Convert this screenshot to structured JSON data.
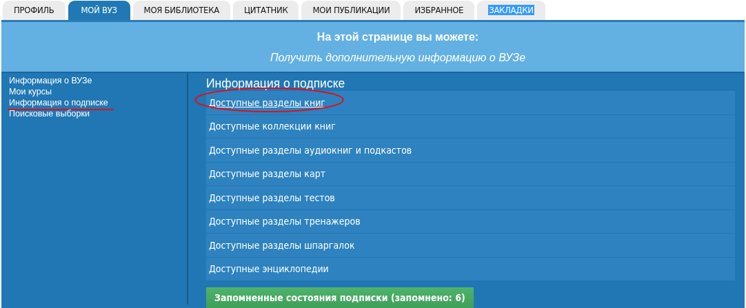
{
  "tabs": [
    {
      "label": "ПРОФИЛЬ",
      "selected": false,
      "highlighted": false
    },
    {
      "label": "МОЙ ВУЗ",
      "selected": true,
      "highlighted": false
    },
    {
      "label": "МОЯ БИБЛИОТЕКА",
      "selected": false,
      "highlighted": false
    },
    {
      "label": "ЦИТАТНИК",
      "selected": false,
      "highlighted": false
    },
    {
      "label": "МОИ ПУБЛИКАЦИИ",
      "selected": false,
      "highlighted": false
    },
    {
      "label": "ИЗБРАННОЕ",
      "selected": false,
      "highlighted": false
    },
    {
      "label": "ЗАКЛАДКИ",
      "selected": false,
      "highlighted": true
    }
  ],
  "header": {
    "title": "На этой странице вы можете:",
    "subtitle": "Получить дополнительную информацию о ВУЗе"
  },
  "sidebar": {
    "items": [
      {
        "label": "Информация о ВУЗе",
        "marked": false
      },
      {
        "label": "Мои курсы",
        "marked": false
      },
      {
        "label": "Информация о подписке",
        "marked": true
      },
      {
        "label": "Поисковые выборки",
        "marked": false
      }
    ]
  },
  "content": {
    "heading": "Информация о подписке",
    "links": [
      {
        "label": "Доступные разделы книг",
        "underlined": true,
        "circled": true
      },
      {
        "label": "Доступные коллекции книг",
        "underlined": false,
        "circled": false
      },
      {
        "label": "Доступные разделы аудиокниг и подкастов",
        "underlined": false,
        "circled": false
      },
      {
        "label": "Доступные разделы карт",
        "underlined": false,
        "circled": false
      },
      {
        "label": "Доступные разделы тестов",
        "underlined": false,
        "circled": false
      },
      {
        "label": "Доступные разделы тренажеров",
        "underlined": false,
        "circled": false
      },
      {
        "label": "Доступные разделы шпаргалок",
        "underlined": false,
        "circled": false
      },
      {
        "label": "Доступные энциклопедии",
        "underlined": false,
        "circled": false
      }
    ],
    "button": "Запомненные состояния подписки (запомнено: 6)"
  }
}
